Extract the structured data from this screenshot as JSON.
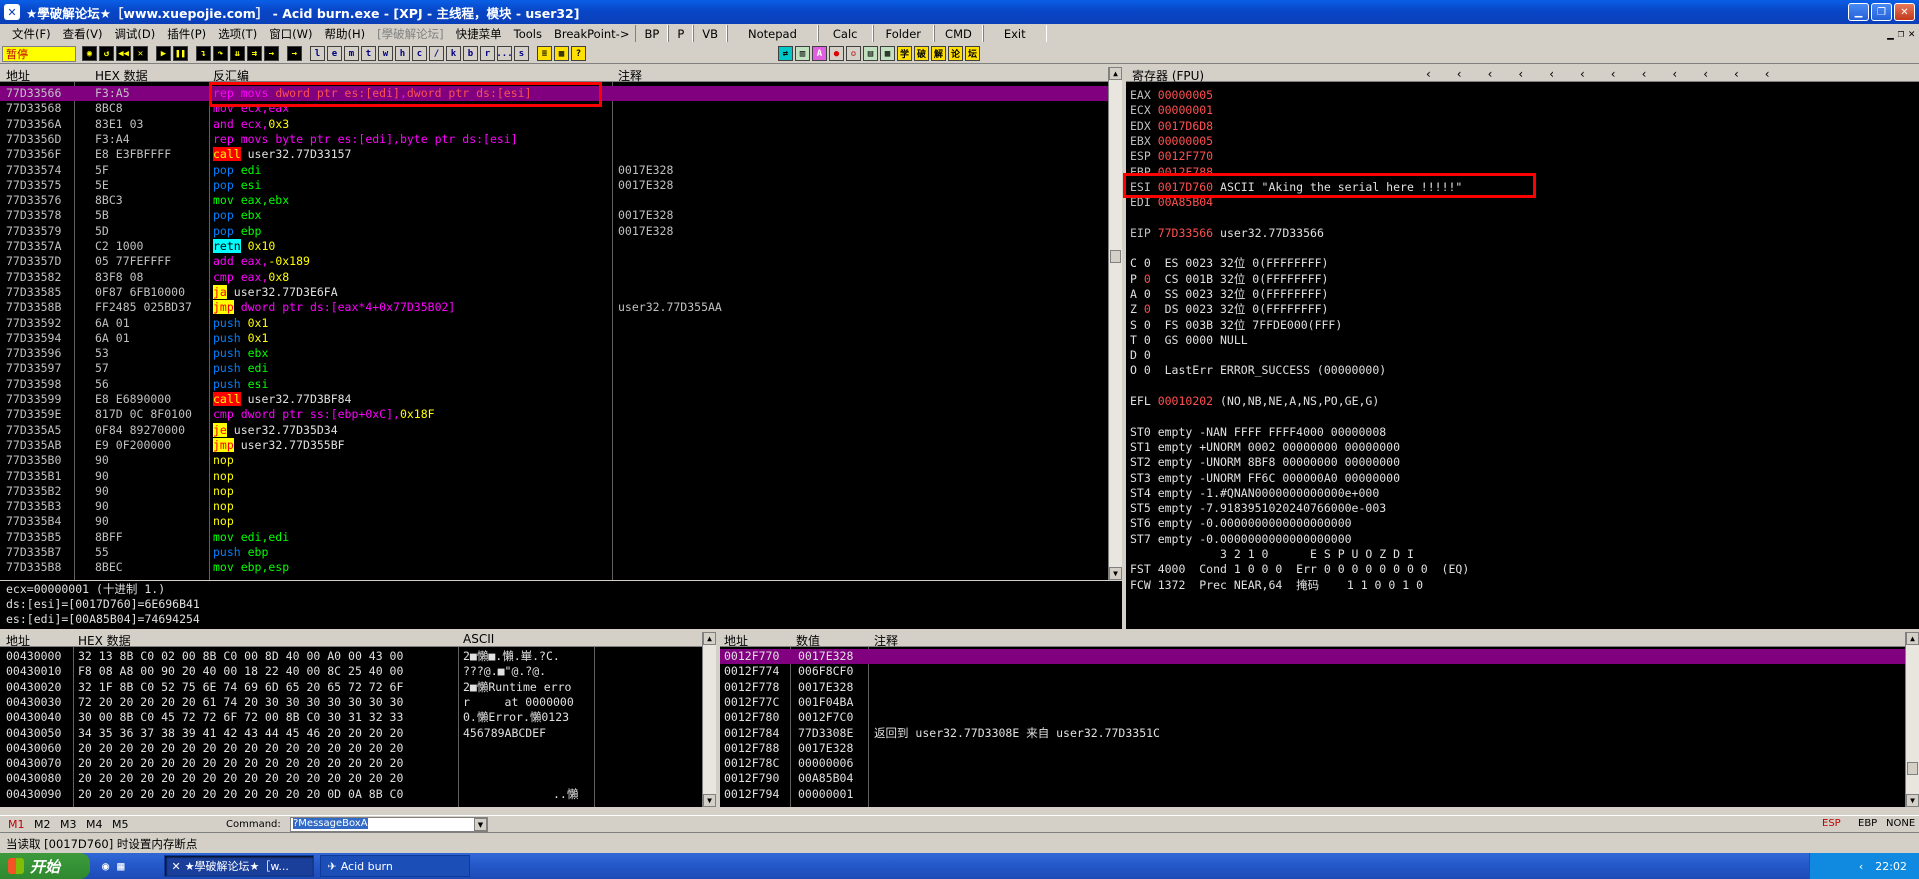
{
  "window": {
    "title": "★學破解论坛★［www.xuepojie.com］ - Acid burn.exe - [XPJ - 主线程，模块 - user32]"
  },
  "menu": {
    "items": [
      "文件(F)",
      "查看(V)",
      "调试(D)",
      "插件(P)",
      "选项(T)",
      "窗口(W)",
      "帮助(H)"
    ],
    "disabled": "[學破解论坛]",
    "extra": [
      "快捷菜单",
      "Tools",
      "BreakPoint->"
    ],
    "tools": [
      "BP",
      "P",
      "VB",
      "Notepad",
      "Calc",
      "Folder",
      "CMD",
      "Exit"
    ]
  },
  "toolbar": {
    "status": "暂停",
    "letters": [
      "l",
      "e",
      "m",
      "t",
      "w",
      "h",
      "c",
      "/",
      "k",
      "b",
      "r",
      "...",
      "s"
    ]
  },
  "disasm": {
    "headers": {
      "addr": "地址",
      "hex": "HEX 数据",
      "asm": "反汇编",
      "comment": "注释"
    },
    "rows": [
      {
        "addr": "77D33566",
        "hex": "F3:A5",
        "asm": [
          [
            "rep movs ",
            "mag"
          ],
          [
            "dword ptr es:[edi]",
            "red"
          ],
          [
            ",",
            "mag"
          ],
          [
            "dword ptr ds:[esi]",
            "red"
          ]
        ],
        "cmt": "",
        "sel": true
      },
      {
        "addr": "77D33568",
        "hex": "8BC8",
        "asm": [
          [
            "mov ecx,eax",
            "mag"
          ]
        ],
        "cmt": ""
      },
      {
        "addr": "77D3356A",
        "hex": "83E1 03",
        "asm": [
          [
            "and ecx,",
            "mag"
          ],
          [
            "0x3",
            "yel"
          ]
        ],
        "cmt": ""
      },
      {
        "addr": "77D3356D",
        "hex": "F3:A4",
        "asm": [
          [
            "rep movs ",
            "mag"
          ],
          [
            "byte ptr es:[edi]",
            "mag"
          ],
          [
            ",",
            "mag"
          ],
          [
            "byte ptr ds:[esi]",
            "mag"
          ]
        ],
        "cmt": ""
      },
      {
        "addr": "77D3356F",
        "hex": "E8 E3FBFFFF",
        "asm": [
          [
            "call",
            "hlred"
          ],
          [
            " user32.77D33157",
            "wht"
          ]
        ],
        "cmt": ""
      },
      {
        "addr": "77D33574",
        "hex": "5F",
        "asm": [
          [
            "pop ",
            "blu"
          ],
          [
            "edi",
            "grn"
          ]
        ],
        "cmt": "0017E328"
      },
      {
        "addr": "77D33575",
        "hex": "5E",
        "asm": [
          [
            "pop ",
            "blu"
          ],
          [
            "esi",
            "grn"
          ]
        ],
        "cmt": "0017E328"
      },
      {
        "addr": "77D33576",
        "hex": "8BC3",
        "asm": [
          [
            "mov eax,ebx",
            "grn"
          ]
        ],
        "cmt": ""
      },
      {
        "addr": "77D33578",
        "hex": "5B",
        "asm": [
          [
            "pop ",
            "blu"
          ],
          [
            "ebx",
            "grn"
          ]
        ],
        "cmt": "0017E328"
      },
      {
        "addr": "77D33579",
        "hex": "5D",
        "asm": [
          [
            "pop ",
            "blu"
          ],
          [
            "ebp",
            "grn"
          ]
        ],
        "cmt": "0017E328"
      },
      {
        "addr": "77D3357A",
        "hex": "C2 1000",
        "asm": [
          [
            "retn",
            "hlcy"
          ],
          [
            " 0x10",
            "yel"
          ]
        ],
        "cmt": ""
      },
      {
        "addr": "77D3357D",
        "hex": "05 77FEFFFF",
        "asm": [
          [
            "add eax,",
            "mag"
          ],
          [
            "-0x189",
            "yel"
          ]
        ],
        "cmt": ""
      },
      {
        "addr": "77D33582",
        "hex": "83F8 08",
        "asm": [
          [
            "cmp eax,",
            "mag"
          ],
          [
            "0x8",
            "yel"
          ]
        ],
        "cmt": ""
      },
      {
        "addr": "77D33585",
        "hex": "0F87 6FB10000",
        "asm": [
          [
            "ja",
            "hlyel"
          ],
          [
            " user32.77D3E6FA",
            "wht"
          ]
        ],
        "cmt": ""
      },
      {
        "addr": "77D3358B",
        "hex": "FF2485 025BD37",
        "asm": [
          [
            "jmp",
            "hlyel"
          ],
          [
            " dword ptr ds:[eax*4+0x77D35B02]",
            "mag"
          ]
        ],
        "cmt": "user32.77D355AA"
      },
      {
        "addr": "77D33592",
        "hex": "6A 01",
        "asm": [
          [
            "push ",
            "blu"
          ],
          [
            "0x1",
            "yel"
          ]
        ],
        "cmt": ""
      },
      {
        "addr": "77D33594",
        "hex": "6A 01",
        "asm": [
          [
            "push ",
            "blu"
          ],
          [
            "0x1",
            "yel"
          ]
        ],
        "cmt": ""
      },
      {
        "addr": "77D33596",
        "hex": "53",
        "asm": [
          [
            "push ",
            "blu"
          ],
          [
            "ebx",
            "grn"
          ]
        ],
        "cmt": ""
      },
      {
        "addr": "77D33597",
        "hex": "57",
        "asm": [
          [
            "push ",
            "blu"
          ],
          [
            "edi",
            "grn"
          ]
        ],
        "cmt": ""
      },
      {
        "addr": "77D33598",
        "hex": "56",
        "asm": [
          [
            "push ",
            "blu"
          ],
          [
            "esi",
            "grn"
          ]
        ],
        "cmt": ""
      },
      {
        "addr": "77D33599",
        "hex": "E8 E6890000",
        "asm": [
          [
            "call",
            "hlred"
          ],
          [
            " user32.77D3BF84",
            "wht"
          ]
        ],
        "cmt": ""
      },
      {
        "addr": "77D3359E",
        "hex": "817D 0C 8F0100",
        "asm": [
          [
            "cmp dword ptr ss:[ebp+0xC],",
            "mag"
          ],
          [
            "0x18F",
            "yel"
          ]
        ],
        "cmt": ""
      },
      {
        "addr": "77D335A5",
        "hex": "0F84 89270000",
        "asm": [
          [
            "je",
            "hlyel"
          ],
          [
            " user32.77D35D34",
            "wht"
          ]
        ],
        "cmt": ""
      },
      {
        "addr": "77D335AB",
        "hex": "E9 0F200000",
        "asm": [
          [
            "jmp",
            "hlyel"
          ],
          [
            " user32.77D355BF",
            "wht"
          ]
        ],
        "cmt": ""
      },
      {
        "addr": "77D335B0",
        "hex": "90",
        "asm": [
          [
            "nop",
            "yel"
          ]
        ],
        "cmt": ""
      },
      {
        "addr": "77D335B1",
        "hex": "90",
        "asm": [
          [
            "nop",
            "yel"
          ]
        ],
        "cmt": ""
      },
      {
        "addr": "77D335B2",
        "hex": "90",
        "asm": [
          [
            "nop",
            "yel"
          ]
        ],
        "cmt": ""
      },
      {
        "addr": "77D335B3",
        "hex": "90",
        "asm": [
          [
            "nop",
            "yel"
          ]
        ],
        "cmt": ""
      },
      {
        "addr": "77D335B4",
        "hex": "90",
        "asm": [
          [
            "nop",
            "yel"
          ]
        ],
        "cmt": ""
      },
      {
        "addr": "77D335B5",
        "hex": "8BFF",
        "asm": [
          [
            "mov edi,edi",
            "grn"
          ]
        ],
        "cmt": ""
      },
      {
        "addr": "77D335B7",
        "hex": "55",
        "asm": [
          [
            "push ",
            "blu"
          ],
          [
            "ebp",
            "grn"
          ]
        ],
        "cmt": ""
      },
      {
        "addr": "77D335B8",
        "hex": "8BEC",
        "asm": [
          [
            "mov ebp,esp",
            "grn"
          ]
        ],
        "cmt": ""
      }
    ]
  },
  "info": {
    "lines": [
      "ecx=00000001 (十进制 1.)",
      "ds:[esi]=[0017D760]=6E696B41",
      "es:[edi]=[00A85B04]=74694254"
    ]
  },
  "registers": {
    "header": "寄存器 (FPU)",
    "lines": [
      [
        [
          "EAX ",
          "gry"
        ],
        [
          "00000005",
          "red"
        ]
      ],
      [
        [
          "ECX ",
          "gry"
        ],
        [
          "00000001",
          "red"
        ]
      ],
      [
        [
          "EDX ",
          "gry"
        ],
        [
          "0017D6D8",
          "red"
        ]
      ],
      [
        [
          "EBX ",
          "gry"
        ],
        [
          "00000005",
          "red"
        ]
      ],
      [
        [
          "ESP ",
          "gry"
        ],
        [
          "0012F770",
          "red"
        ]
      ],
      [
        [
          "EBP ",
          "gry"
        ],
        [
          "0012F788",
          "red"
        ]
      ],
      [
        [
          "ESI ",
          "gry"
        ],
        [
          "0017D760",
          "red"
        ],
        [
          " ASCII \"Aking the serial here !!!!!\"",
          "wht"
        ]
      ],
      [
        [
          "EDI ",
          "gry"
        ],
        [
          "00A85B04",
          "red"
        ]
      ],
      [
        [
          "",
          "gry"
        ]
      ],
      [
        [
          "EIP ",
          "gry"
        ],
        [
          "77D33566",
          "red"
        ],
        [
          " user32.77D33566",
          "wht"
        ]
      ],
      [
        [
          "",
          "gry"
        ]
      ],
      [
        [
          "C 0  ES 0023 32位 0(FFFFFFFF)",
          "wht"
        ]
      ],
      [
        [
          "P ",
          "wht"
        ],
        [
          "0",
          "red"
        ],
        [
          "  CS 001B 32位 0(FFFFFFFF)",
          "wht"
        ]
      ],
      [
        [
          "A 0  SS 0023 32位 0(FFFFFFFF)",
          "wht"
        ]
      ],
      [
        [
          "Z ",
          "wht"
        ],
        [
          "0",
          "red"
        ],
        [
          "  DS 0023 32位 0(FFFFFFFF)",
          "wht"
        ]
      ],
      [
        [
          "S 0  FS 003B 32位 7FFDE000(FFF)",
          "wht"
        ]
      ],
      [
        [
          "T 0  GS 0000 NULL",
          "wht"
        ]
      ],
      [
        [
          "D 0",
          "wht"
        ]
      ],
      [
        [
          "O 0  LastErr ERROR_SUCCESS (00000000)",
          "wht"
        ]
      ],
      [
        [
          "",
          "gry"
        ]
      ],
      [
        [
          "EFL ",
          "wht"
        ],
        [
          "00010202",
          "red"
        ],
        [
          " (NO,NB,NE,A,NS,PO,GE,G)",
          "wht"
        ]
      ],
      [
        [
          "",
          "gry"
        ]
      ],
      [
        [
          "ST0 empty -NAN FFFF FFFF4000 00000008",
          "wht"
        ]
      ],
      [
        [
          "ST1 empty +UNORM 0002 00000000 00000000",
          "wht"
        ]
      ],
      [
        [
          "ST2 empty -UNORM 8BF8 00000000 00000000",
          "wht"
        ]
      ],
      [
        [
          "ST3 empty -UNORM FF6C 000000A0 00000000",
          "wht"
        ]
      ],
      [
        [
          "ST4 empty -1.#QNAN0000000000000e+000",
          "wht"
        ]
      ],
      [
        [
          "ST5 empty -7.9183951020240766000e-003",
          "wht"
        ]
      ],
      [
        [
          "ST6 empty -0.0000000000000000000",
          "wht"
        ]
      ],
      [
        [
          "ST7 empty -0.0000000000000000000",
          "wht"
        ]
      ],
      [
        [
          "             3 2 1 0      E S P U O Z D I",
          "wht"
        ]
      ],
      [
        [
          "FST 4000  Cond 1 0 0 0  Err 0 0 0 0 0 0 0 0  (EQ)",
          "wht"
        ]
      ],
      [
        [
          "FCW 1372  Prec NEAR,64  掩码    1 1 0 0 1 0",
          "wht"
        ]
      ]
    ]
  },
  "dump": {
    "headers": {
      "addr": "地址",
      "hex": "HEX 数据",
      "ascii": "ASCII"
    },
    "rows": [
      {
        "addr": "00430000",
        "hex": "32 13 8B C0 02 00 8B C0 00 8D 40 00 A0 00 43 00",
        "ascii": "2■懶■.懶.崋.?C."
      },
      {
        "addr": "00430010",
        "hex": "F8 08 A8 00 90 20 40 00 18 22 40 00 8C 25 40 00",
        "ascii": "???@.■\"@.?@."
      },
      {
        "addr": "00430020",
        "hex": "32 1F 8B C0 52 75 6E 74 69 6D 65 20 65 72 72 6F",
        "ascii": "2■懶Runtime erro"
      },
      {
        "addr": "00430030",
        "hex": "72 20 20 20 20 20 61 74 20 30 30 30 30 30 30 30",
        "ascii": "r     at 0000000"
      },
      {
        "addr": "00430040",
        "hex": "30 00 8B C0 45 72 72 6F 72 00 8B C0 30 31 32 33",
        "ascii": "0.懶Error.懶0123"
      },
      {
        "addr": "00430050",
        "hex": "34 35 36 37 38 39 41 42 43 44 45 46 20 20 20 20",
        "ascii": "456789ABCDEF    "
      },
      {
        "addr": "00430060",
        "hex": "20 20 20 20 20 20 20 20 20 20 20 20 20 20 20 20",
        "ascii": ""
      },
      {
        "addr": "00430070",
        "hex": "20 20 20 20 20 20 20 20 20 20 20 20 20 20 20 20",
        "ascii": ""
      },
      {
        "addr": "00430080",
        "hex": "20 20 20 20 20 20 20 20 20 20 20 20 20 20 20 20",
        "ascii": ""
      },
      {
        "addr": "00430090",
        "hex": "20 20 20 20 20 20 20 20 20 20 20 20 0D 0A 8B C0",
        "ascii": "             ..懶"
      }
    ]
  },
  "stack": {
    "headers": {
      "addr": "地址",
      "value": "数值",
      "comment": "注释"
    },
    "rows": [
      {
        "addr": "0012F770",
        "value": "0017E328",
        "cmt": "",
        "sel": true
      },
      {
        "addr": "0012F774",
        "value": "006F8CF0",
        "cmt": ""
      },
      {
        "addr": "0012F778",
        "value": "0017E328",
        "cmt": ""
      },
      {
        "addr": "0012F77C",
        "value": "001F04BA",
        "cmt": ""
      },
      {
        "addr": "0012F780",
        "value": "0012F7C0",
        "cmt": ""
      },
      {
        "addr": "0012F784",
        "value": "77D3308E",
        "cmt": "返回到 user32.77D3308E 来自 user32.77D3351C"
      },
      {
        "addr": "0012F788",
        "value": "0017E328",
        "cmt": ""
      },
      {
        "addr": "0012F78C",
        "value": "00000006",
        "cmt": ""
      },
      {
        "addr": "0012F790",
        "value": "00A85B04",
        "cmt": ""
      },
      {
        "addr": "0012F794",
        "value": "00000001",
        "cmt": ""
      }
    ]
  },
  "bottom": {
    "mtabs": [
      "M1",
      "M2",
      "M3",
      "M4",
      "M5"
    ],
    "command_label": "Command:",
    "command_value": "?MessageBoxA",
    "right_labels": [
      "ESP",
      "EBP",
      "NONE"
    ],
    "status": "当读取 [0017D760] 时设置内存断点"
  },
  "taskbar": {
    "start": "开始",
    "items": [
      "★學破解论坛★［w...",
      "Acid burn"
    ],
    "time": "22:02"
  },
  "colors": {
    "mag": "#ff00ff",
    "red": "#ff3030",
    "yel": "#ffff00",
    "blu": "#0080ff",
    "grn": "#00ff00",
    "wht": "#e0e0e0",
    "gry": "#c0c0c0",
    "sel": "#800080"
  }
}
